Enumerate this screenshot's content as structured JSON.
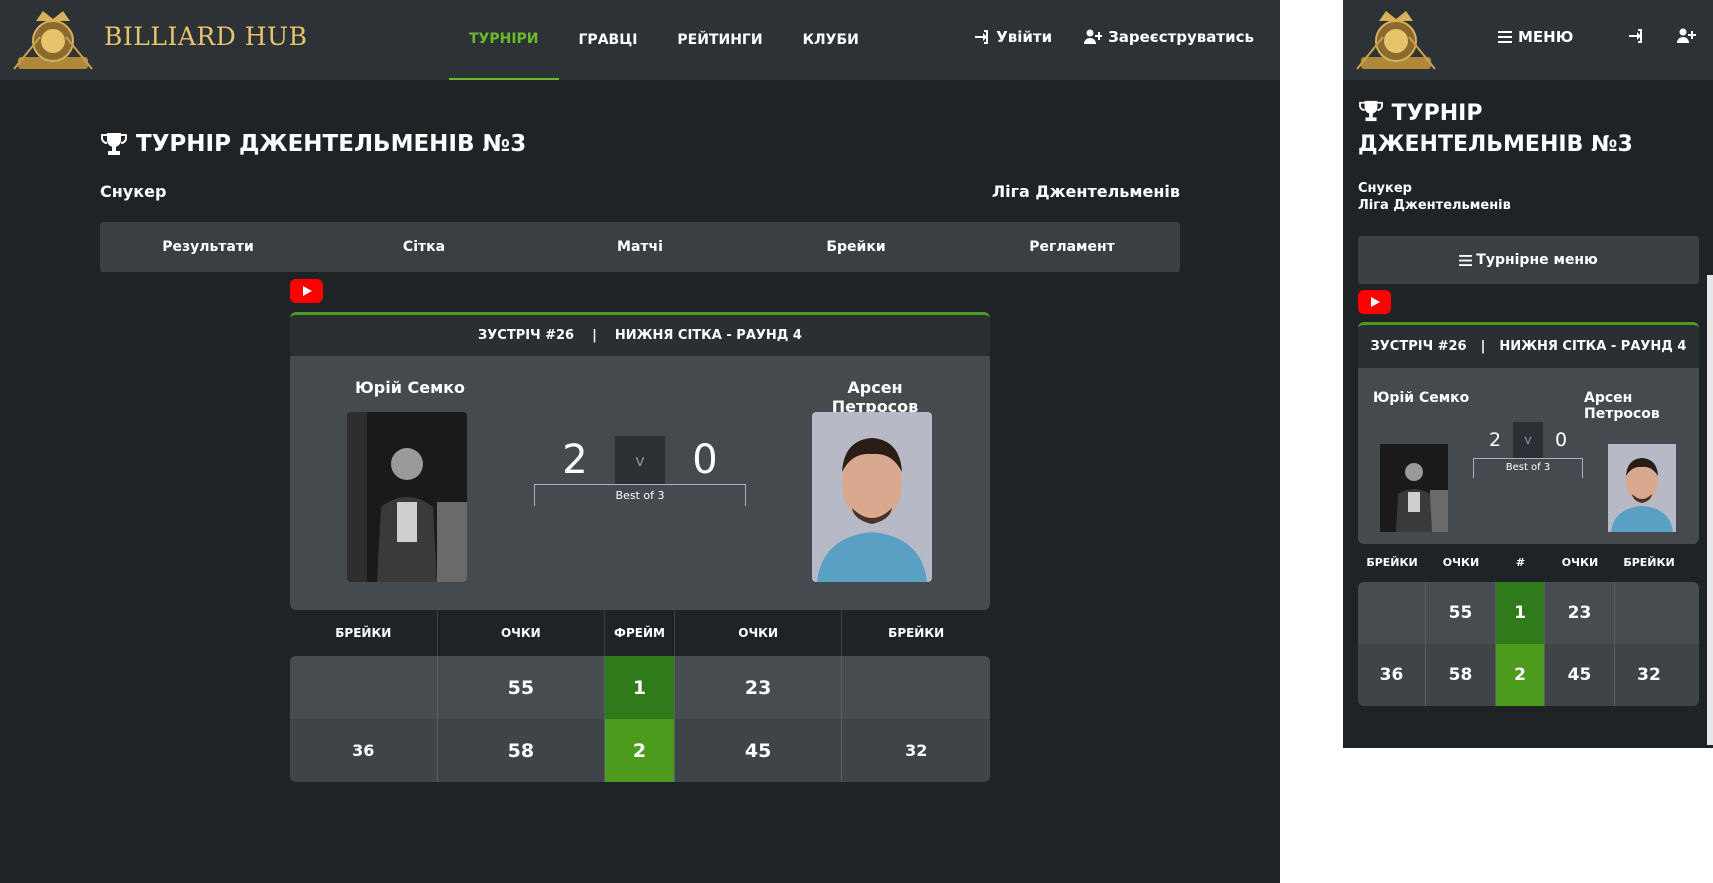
{
  "brand": {
    "name": "BILLIARD HUB"
  },
  "nav": {
    "links": [
      "ТУРНІРИ",
      "ГРАВЦІ",
      "РЕЙТИНГИ",
      "КЛУБИ"
    ],
    "login": "Увійти",
    "register": "Зареєструватись",
    "mobile_menu": "МЕНЮ"
  },
  "tournament": {
    "title": "ТУРНІР ДЖЕНТЕЛЬМЕНІВ №3",
    "type": "Снукер",
    "league": "Ліга Джентельменів",
    "tabs": [
      "Результати",
      "Сітка",
      "Матчі",
      "Брейки",
      "Регламент"
    ],
    "mobile_menu_label": "Турнірне меню"
  },
  "match": {
    "number": "ЗУСТРІЧ #26",
    "separator": "|",
    "round": "НИЖНЯ СІТКА - РАУНД 4",
    "player1": "Юрій Семко",
    "player2": "Арсен Петросов",
    "score1": "2",
    "score2": "0",
    "vs": "v",
    "best_of": "Best of 3"
  },
  "frames": {
    "headers": [
      "БРЕЙКИ",
      "ОЧКИ",
      "ФРЕЙМ",
      "ОЧКИ",
      "БРЕЙКИ"
    ],
    "mobile_frame_header": "#",
    "rows": [
      {
        "breaks1": "",
        "points1": "55",
        "frame": "1",
        "points2": "23",
        "breaks2": ""
      },
      {
        "breaks1": "36",
        "points1": "58",
        "frame": "2",
        "points2": "45",
        "breaks2": "32"
      }
    ]
  },
  "colors": {
    "accent": "#4c9b1c",
    "active_nav": "#6fb82b",
    "brand": "#e6c46b",
    "youtube": "#ff0000"
  },
  "icons": [
    "trophy-icon",
    "login-icon",
    "user-plus-icon",
    "hamburger-icon",
    "youtube-icon"
  ]
}
